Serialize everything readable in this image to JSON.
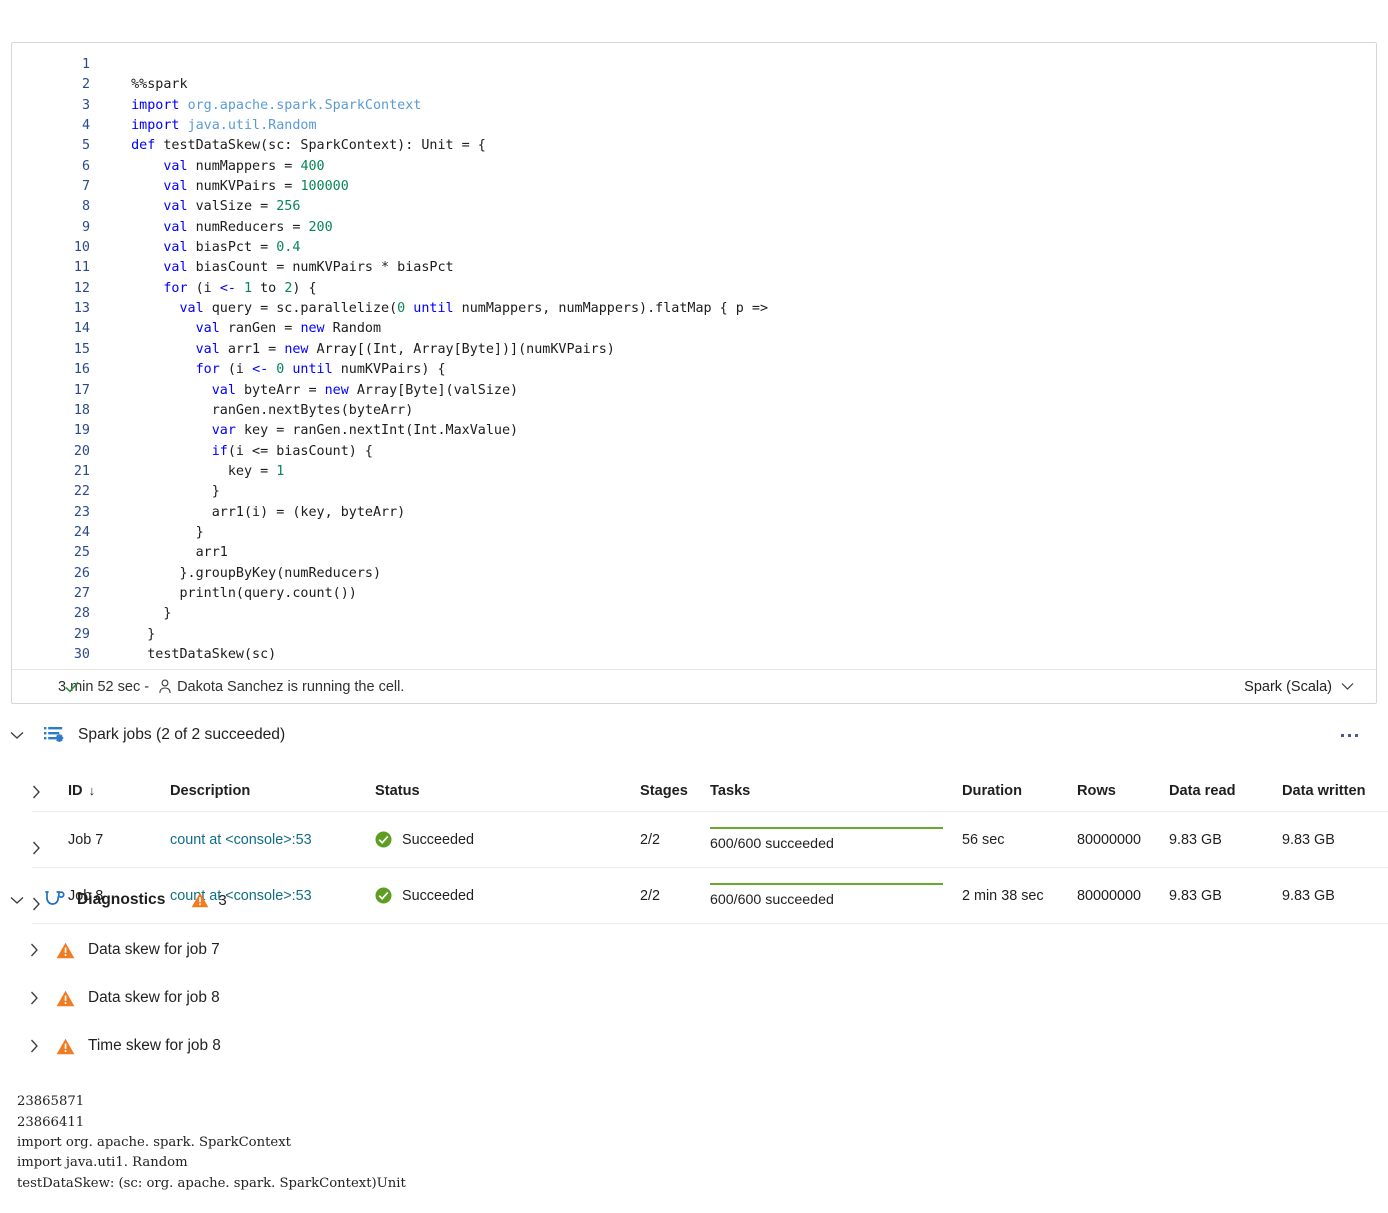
{
  "cell": {
    "lines": [
      {
        "n": "1",
        "tokens": []
      },
      {
        "n": "2",
        "tokens": [
          {
            "t": "  %%spark",
            "c": "plain"
          }
        ]
      },
      {
        "n": "3",
        "tokens": [
          {
            "t": "  ",
            "c": "plain"
          },
          {
            "t": "import",
            "c": "kw"
          },
          {
            "t": " ",
            "c": "plain"
          },
          {
            "t": "org.apache.spark.SparkContext",
            "c": "pkg"
          }
        ]
      },
      {
        "n": "4",
        "tokens": [
          {
            "t": "  ",
            "c": "plain"
          },
          {
            "t": "import",
            "c": "kw"
          },
          {
            "t": " ",
            "c": "plain"
          },
          {
            "t": "java.util.Random",
            "c": "pkg"
          }
        ]
      },
      {
        "n": "5",
        "tokens": [
          {
            "t": "  ",
            "c": "plain"
          },
          {
            "t": "def",
            "c": "kw"
          },
          {
            "t": " testDataSkew(sc: SparkContext): Unit = {",
            "c": "plain"
          }
        ]
      },
      {
        "n": "6",
        "tokens": [
          {
            "t": "      ",
            "c": "plain"
          },
          {
            "t": "val",
            "c": "kw"
          },
          {
            "t": " numMappers = ",
            "c": "plain"
          },
          {
            "t": "400",
            "c": "num"
          }
        ]
      },
      {
        "n": "7",
        "tokens": [
          {
            "t": "      ",
            "c": "plain"
          },
          {
            "t": "val",
            "c": "kw"
          },
          {
            "t": " numKVPairs = ",
            "c": "plain"
          },
          {
            "t": "100000",
            "c": "num"
          }
        ]
      },
      {
        "n": "8",
        "tokens": [
          {
            "t": "      ",
            "c": "plain"
          },
          {
            "t": "val",
            "c": "kw"
          },
          {
            "t": " valSize = ",
            "c": "plain"
          },
          {
            "t": "256",
            "c": "num"
          }
        ]
      },
      {
        "n": "9",
        "tokens": [
          {
            "t": "      ",
            "c": "plain"
          },
          {
            "t": "val",
            "c": "kw"
          },
          {
            "t": " numReducers = ",
            "c": "plain"
          },
          {
            "t": "200",
            "c": "num"
          }
        ]
      },
      {
        "n": "10",
        "tokens": [
          {
            "t": "      ",
            "c": "plain"
          },
          {
            "t": "val",
            "c": "kw"
          },
          {
            "t": " biasPct = ",
            "c": "plain"
          },
          {
            "t": "0.4",
            "c": "num"
          }
        ]
      },
      {
        "n": "11",
        "tokens": [
          {
            "t": "      ",
            "c": "plain"
          },
          {
            "t": "val",
            "c": "kw"
          },
          {
            "t": " biasCount = numKVPairs * biasPct",
            "c": "plain"
          }
        ]
      },
      {
        "n": "12",
        "tokens": [
          {
            "t": "      ",
            "c": "plain"
          },
          {
            "t": "for",
            "c": "kw"
          },
          {
            "t": " (i ",
            "c": "plain"
          },
          {
            "t": "<-",
            "c": "kw"
          },
          {
            "t": " ",
            "c": "plain"
          },
          {
            "t": "1",
            "c": "num"
          },
          {
            "t": " to ",
            "c": "plain"
          },
          {
            "t": "2",
            "c": "num"
          },
          {
            "t": ") {",
            "c": "plain"
          }
        ]
      },
      {
        "n": "13",
        "tokens": [
          {
            "t": "        ",
            "c": "plain"
          },
          {
            "t": "val",
            "c": "kw"
          },
          {
            "t": " query = sc.parallelize(",
            "c": "plain"
          },
          {
            "t": "0",
            "c": "num"
          },
          {
            "t": " ",
            "c": "plain"
          },
          {
            "t": "until",
            "c": "kw"
          },
          {
            "t": " numMappers, numMappers).flatMap { p =>",
            "c": "plain"
          }
        ]
      },
      {
        "n": "14",
        "tokens": [
          {
            "t": "          ",
            "c": "plain"
          },
          {
            "t": "val",
            "c": "kw"
          },
          {
            "t": " ranGen = ",
            "c": "plain"
          },
          {
            "t": "new",
            "c": "kw"
          },
          {
            "t": " Random",
            "c": "plain"
          }
        ]
      },
      {
        "n": "15",
        "tokens": [
          {
            "t": "          ",
            "c": "plain"
          },
          {
            "t": "val",
            "c": "kw"
          },
          {
            "t": " arr1 = ",
            "c": "plain"
          },
          {
            "t": "new",
            "c": "kw"
          },
          {
            "t": " Array[(Int, Array[Byte])](numKVPairs)",
            "c": "plain"
          }
        ]
      },
      {
        "n": "16",
        "tokens": [
          {
            "t": "          ",
            "c": "plain"
          },
          {
            "t": "for",
            "c": "kw"
          },
          {
            "t": " (i ",
            "c": "plain"
          },
          {
            "t": "<-",
            "c": "kw"
          },
          {
            "t": " ",
            "c": "plain"
          },
          {
            "t": "0",
            "c": "num"
          },
          {
            "t": " ",
            "c": "plain"
          },
          {
            "t": "until",
            "c": "kw"
          },
          {
            "t": " numKVPairs) {",
            "c": "plain"
          }
        ]
      },
      {
        "n": "17",
        "tokens": [
          {
            "t": "            ",
            "c": "plain"
          },
          {
            "t": "val",
            "c": "kw"
          },
          {
            "t": " byteArr = ",
            "c": "plain"
          },
          {
            "t": "new",
            "c": "kw"
          },
          {
            "t": " Array[Byte](valSize)",
            "c": "plain"
          }
        ]
      },
      {
        "n": "18",
        "tokens": [
          {
            "t": "            ranGen.nextBytes(byteArr)",
            "c": "plain"
          }
        ]
      },
      {
        "n": "19",
        "tokens": [
          {
            "t": "            ",
            "c": "plain"
          },
          {
            "t": "var",
            "c": "kw"
          },
          {
            "t": " key = ranGen.nextInt(Int.MaxValue)",
            "c": "plain"
          }
        ]
      },
      {
        "n": "20",
        "tokens": [
          {
            "t": "            ",
            "c": "plain"
          },
          {
            "t": "if",
            "c": "kw"
          },
          {
            "t": "(i <= biasCount) {",
            "c": "plain"
          }
        ]
      },
      {
        "n": "21",
        "tokens": [
          {
            "t": "              key = ",
            "c": "plain"
          },
          {
            "t": "1",
            "c": "num"
          }
        ]
      },
      {
        "n": "22",
        "tokens": [
          {
            "t": "            }",
            "c": "plain"
          }
        ]
      },
      {
        "n": "23",
        "tokens": [
          {
            "t": "            arr1(i) = (key, byteArr)",
            "c": "plain"
          }
        ]
      },
      {
        "n": "24",
        "tokens": [
          {
            "t": "          }",
            "c": "plain"
          }
        ]
      },
      {
        "n": "25",
        "tokens": [
          {
            "t": "          arr1",
            "c": "plain"
          }
        ]
      },
      {
        "n": "26",
        "tokens": [
          {
            "t": "        }.groupByKey(numReducers)",
            "c": "plain"
          }
        ]
      },
      {
        "n": "27",
        "tokens": [
          {
            "t": "        println(query.count())",
            "c": "plain"
          }
        ]
      },
      {
        "n": "28",
        "tokens": [
          {
            "t": "      }",
            "c": "plain"
          }
        ]
      },
      {
        "n": "29",
        "tokens": [
          {
            "t": "    }",
            "c": "plain"
          }
        ]
      },
      {
        "n": "30",
        "tokens": [
          {
            "t": "    testDataSkew(sc)",
            "c": "plain"
          }
        ]
      }
    ],
    "status": {
      "duration": "3 min 52 sec -",
      "running_by": "Dakota Sanchez is running the cell.",
      "language": "Spark (Scala)"
    }
  },
  "spark_jobs": {
    "title": "Spark jobs (2 of 2 succeeded)",
    "columns": {
      "id": "ID",
      "description": "Description",
      "status": "Status",
      "stages": "Stages",
      "tasks": "Tasks",
      "duration": "Duration",
      "rows": "Rows",
      "data_read": "Data read",
      "data_written": "Data written",
      "sort_arrow": "↓"
    },
    "rows": [
      {
        "id": "Job 7",
        "description": "count at <console>:53",
        "status": "Succeeded",
        "stages": "2/2",
        "tasks": "600/600 succeeded",
        "tasks_pct": 100,
        "duration": "56 sec",
        "rows": "80000000",
        "data_read": "9.83 GB",
        "data_written": "9.83 GB"
      },
      {
        "id": "Job 8",
        "description": "count at <console>:53",
        "status": "Succeeded",
        "stages": "2/2",
        "tasks": "600/600 succeeded",
        "tasks_pct": 100,
        "duration": "2 min 38 sec",
        "rows": "80000000",
        "data_read": "9.83 GB",
        "data_written": "9.83 GB"
      }
    ]
  },
  "diagnostics": {
    "title": "Diagnostics",
    "warning_count": "3",
    "items": [
      {
        "label": "Data skew for job 7"
      },
      {
        "label": "Data skew for job 8"
      },
      {
        "label": "Time skew for job 8"
      }
    ]
  },
  "console_output": "23865871\n23866411\nimport org. apache. spark. SparkContext\nimport java.uti1. Random\ntestDataSkew: (sc: org. apache. spark. SparkContext)Unit",
  "colors": {
    "keyword": "#0000ff",
    "package": "#5b9bd5",
    "number": "#098658",
    "link": "#0f6e84",
    "success": "#5d9e23",
    "warning": "#f07c22",
    "accent": "#1f6fc4"
  }
}
